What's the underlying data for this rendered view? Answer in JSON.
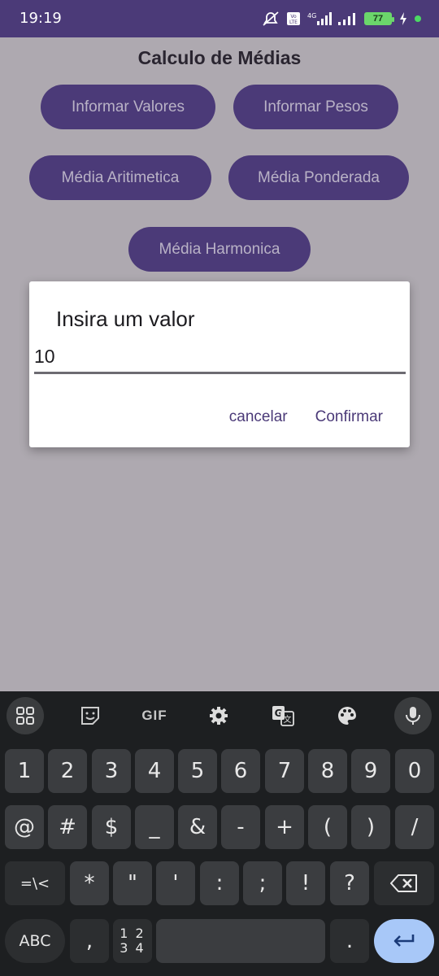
{
  "status": {
    "time": "19:19",
    "battery": "77"
  },
  "app": {
    "title": "Calculo de Médias",
    "buttons": {
      "informar_valores": "Informar Valores",
      "informar_pesos": "Informar Pesos",
      "media_aritimetica": "Média Aritimetica",
      "media_ponderada": "Média Ponderada",
      "media_harmonica": "Média Harmonica"
    }
  },
  "dialog": {
    "title": "Insira um valor",
    "input_value": "10",
    "cancel_label": "cancelar",
    "confirm_label": "Confirmar"
  },
  "keyboard": {
    "toolbar": {
      "gif_label": "GIF"
    },
    "row1": [
      "1",
      "2",
      "3",
      "4",
      "5",
      "6",
      "7",
      "8",
      "9",
      "0"
    ],
    "row2": [
      "@",
      "#",
      "$",
      "_",
      "&",
      "-",
      "+",
      "(",
      ")",
      "/"
    ],
    "row3": [
      "=\\<",
      "*",
      "\"",
      "'",
      ":",
      ";",
      "!",
      "?"
    ],
    "abc_label": "ABC",
    "comma_label": ",",
    "numbers_top": "1 2",
    "numbers_bottom": "3 4",
    "period_label": "."
  },
  "colors": {
    "accent": "#4b3a78",
    "scrim": "#aea9b0",
    "keyboard_bg": "#1d1f21",
    "enter_key": "#a8c8f8"
  }
}
